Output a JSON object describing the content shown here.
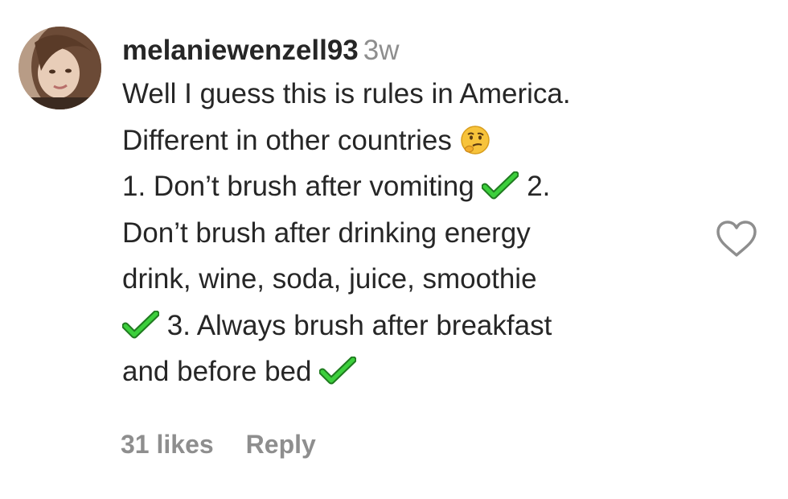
{
  "comment": {
    "username": "melaniewenzell93",
    "time": "3w",
    "lines": [
      "Well I guess this is rules in America.",
      "Different in other countries",
      "1. Don’t brush after vomiting",
      "2.",
      "Don’t brush after drinking energy",
      "drink, wine, soda, juice, smoothie",
      "3. Always brush after breakfast",
      "and before bed"
    ],
    "icons": {
      "thinking": "thinking-face-emoji",
      "check": "heavy-check-mark-emoji",
      "like": "heart-outline-icon"
    }
  },
  "actions": {
    "likes": "31 likes",
    "reply": "Reply"
  },
  "colors": {
    "text": "#262626",
    "secondary": "#8e8e8e",
    "check": "#2db52d"
  }
}
